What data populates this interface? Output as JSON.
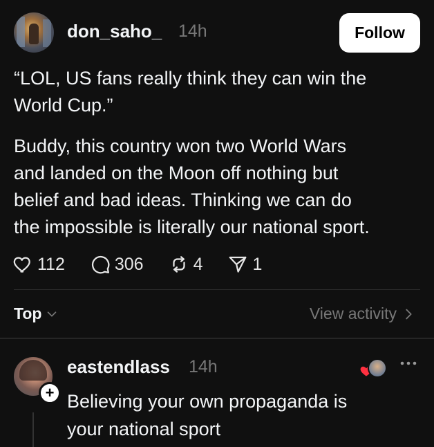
{
  "post": {
    "username": "don_saho_",
    "time": "14h",
    "follow_label": "Follow",
    "paragraph1": "“LOL, US fans really think they can win the\nWorld Cup.”",
    "paragraph2": "Buddy, this country won two World Wars\nand landed on the Moon off nothing but\nbelief and bad ideas. Thinking we can do\nthe impossible is literally our national sport.",
    "likes": "112",
    "replies": "306",
    "reposts": "4",
    "shares": "1"
  },
  "thread_bar": {
    "sort_label": "Top",
    "view_activity_label": "View activity"
  },
  "reply": {
    "username": "eastendlass",
    "time": "14h",
    "text": "Believing your own propaganda is\nyour national sport"
  },
  "colors": {
    "background": "#101010",
    "text_primary": "#f3f5f7",
    "text_secondary": "#777777",
    "follow_bg": "#ffffff",
    "heart_red": "#ff3040"
  },
  "icons": {
    "like": "heart-outline-icon",
    "reply": "comment-bubble-icon",
    "repost": "repost-icon",
    "share": "send-icon",
    "sort": "chevron-down-icon",
    "view_activity": "chevron-right-icon",
    "more": "more-horizontal-icon",
    "add": "plus-icon"
  }
}
